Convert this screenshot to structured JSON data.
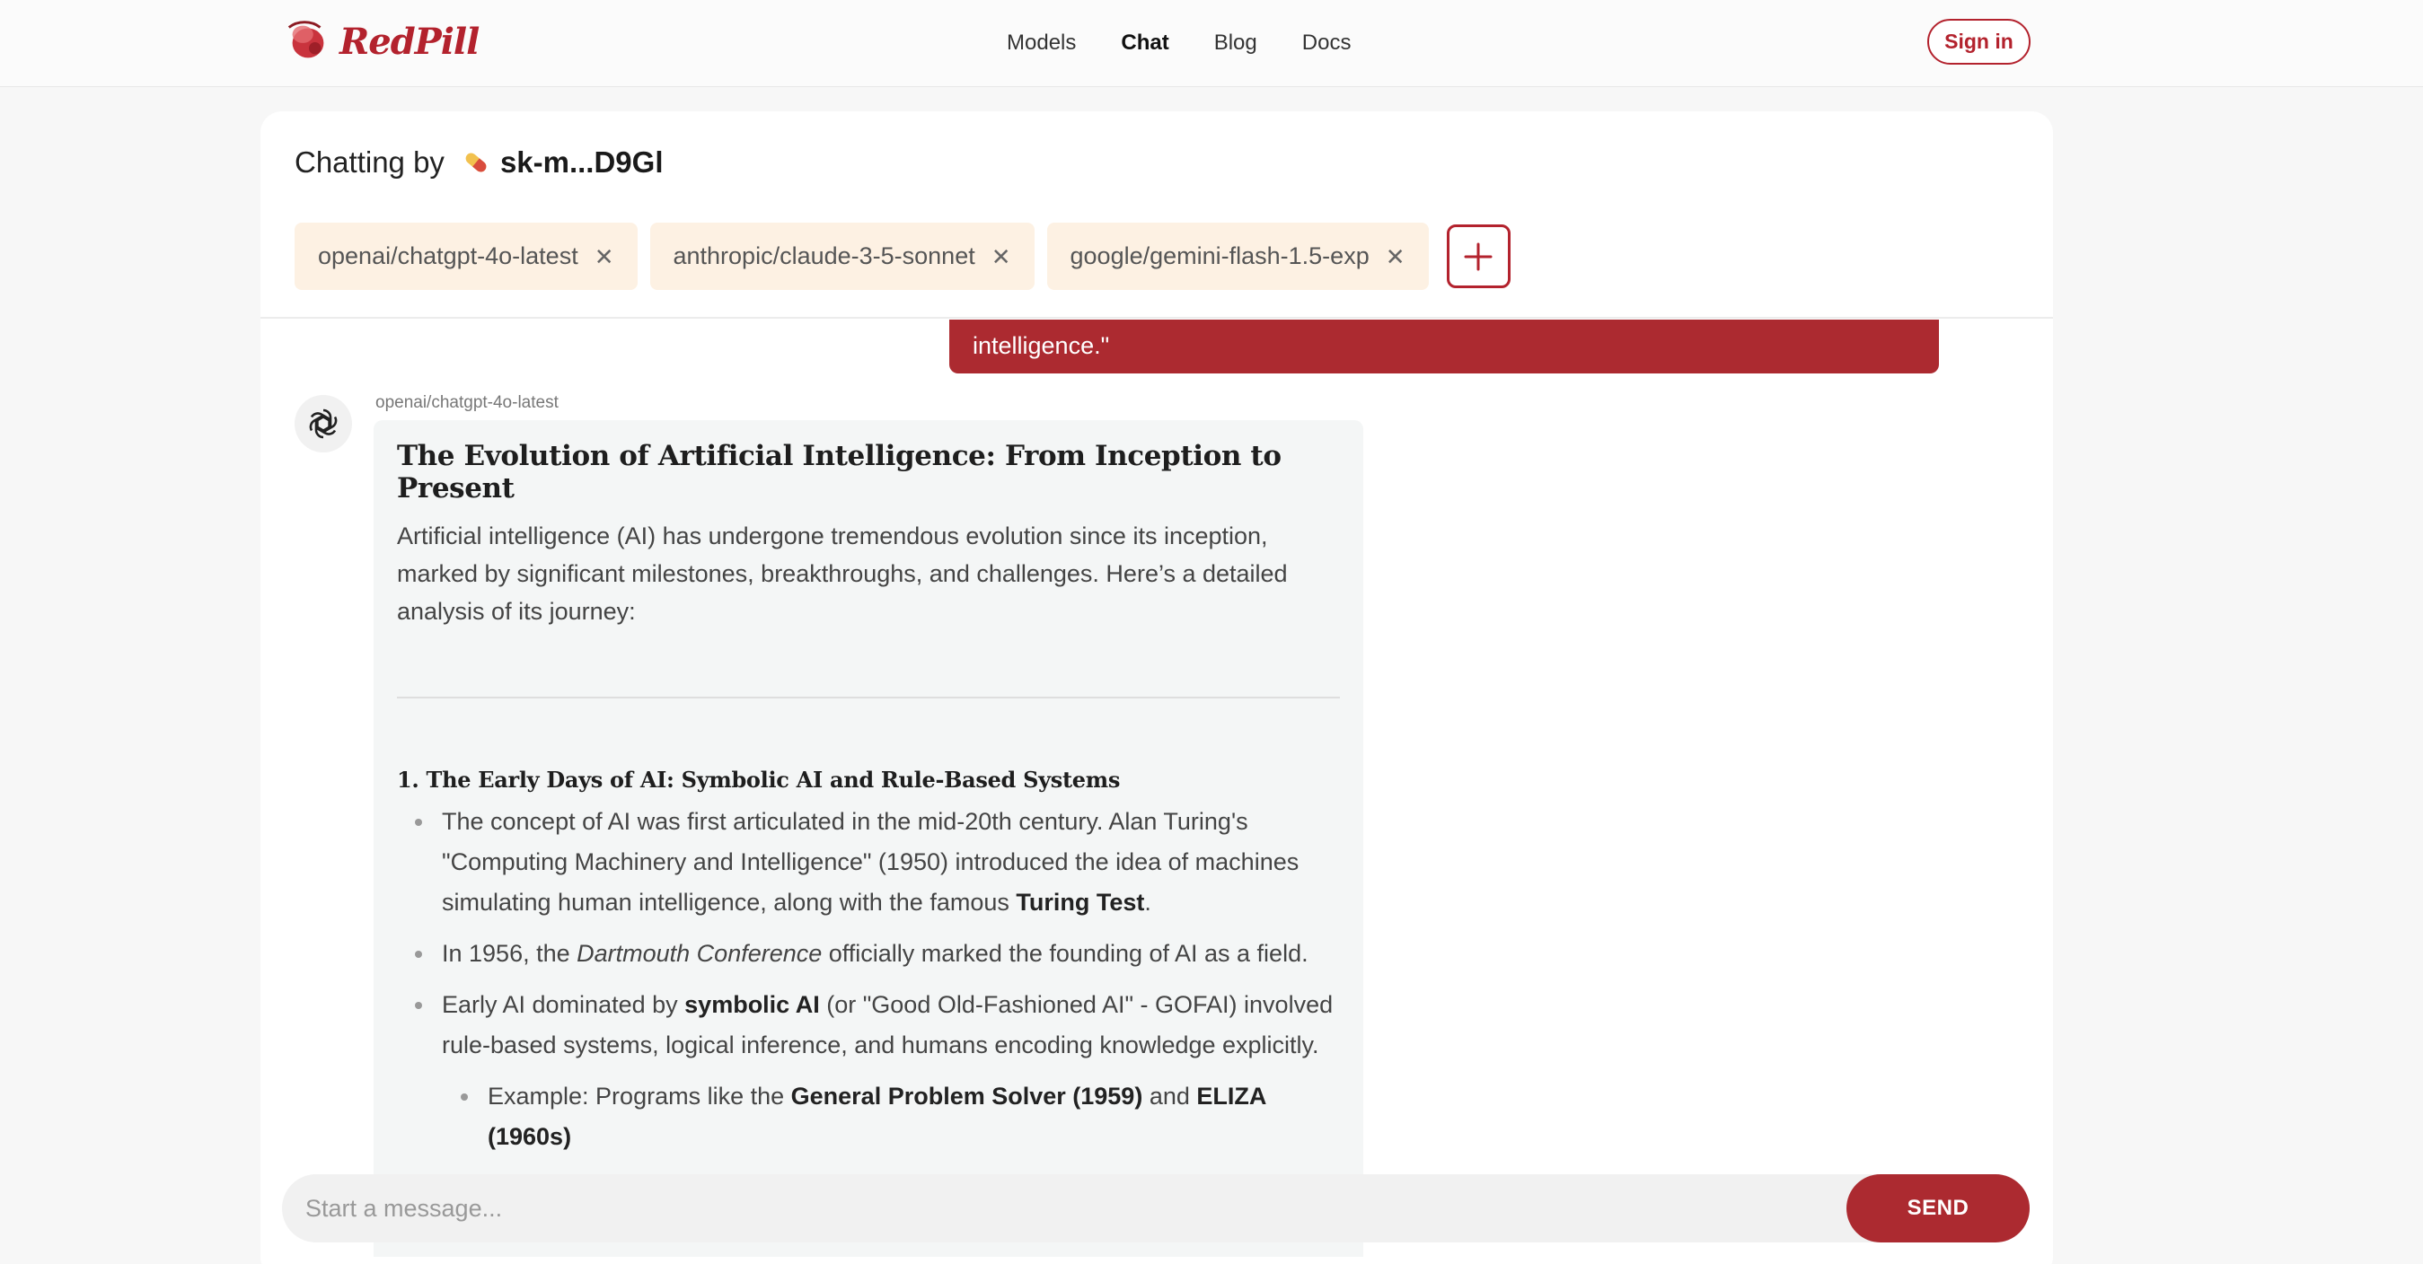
{
  "brand": {
    "name": "RedPill",
    "accent": "#b3222d"
  },
  "nav": {
    "items": [
      {
        "label": "Models",
        "active": false
      },
      {
        "label": "Chat",
        "active": true
      },
      {
        "label": "Blog",
        "active": false
      },
      {
        "label": "Docs",
        "active": false
      }
    ],
    "signin_label": "Sign in"
  },
  "chat_header": {
    "prefix": "Chatting by",
    "key_icon": "pill-icon",
    "key_name": "sk-m...D9Gl",
    "models": [
      {
        "label": "openai/chatgpt-4o-latest",
        "remove_icon": "close-icon"
      },
      {
        "label": "anthropic/claude-3-5-sonnet",
        "remove_icon": "close-icon"
      },
      {
        "label": "google/gemini-flash-1.5-exp",
        "remove_icon": "close-icon"
      }
    ],
    "add_icon": "plus-icon"
  },
  "messages": {
    "user_tail": "intelligence.\"",
    "assistant": {
      "model": "openai/chatgpt-4o-latest",
      "avatar_icon": "openai-logo-icon",
      "title": "The Evolution of Artificial Intelligence: From Inception to Present",
      "intro": "Artificial intelligence (AI) has undergone tremendous evolution since its inception, marked by significant milestones, breakthroughs, and challenges. Here’s a detailed analysis of its journey:",
      "section1_title": "1. The Early Days of AI: Symbolic AI and Rule-Based Systems",
      "bullets": {
        "b1_a": "The concept of AI was first articulated in the mid-20th century. Alan Turing's \"Computing Machinery and Intelligence\" (1950) introduced the idea of machines simulating human intelligence, along with the famous ",
        "b1_bold": "Turing Test",
        "b1_c": ".",
        "b2_a": "In 1956, the ",
        "b2_italic": "Dartmouth Conference",
        "b2_c": " officially marked the founding of AI as a field.",
        "b3_a": "Early AI dominated by ",
        "b3_bold": "symbolic AI",
        "b3_c": " (or \"Good Old-Fashioned AI\" - GOFAI) involved rule-based systems, logical inference, and humans encoding knowledge explicitly.",
        "sub_a": "Example: Programs like the ",
        "sub_bold1": "General Problem Solver (1959)",
        "sub_mid": " and ",
        "sub_bold2": "ELIZA (1960s)"
      }
    }
  },
  "composer": {
    "placeholder": "Start a message...",
    "send_label": "SEND"
  }
}
